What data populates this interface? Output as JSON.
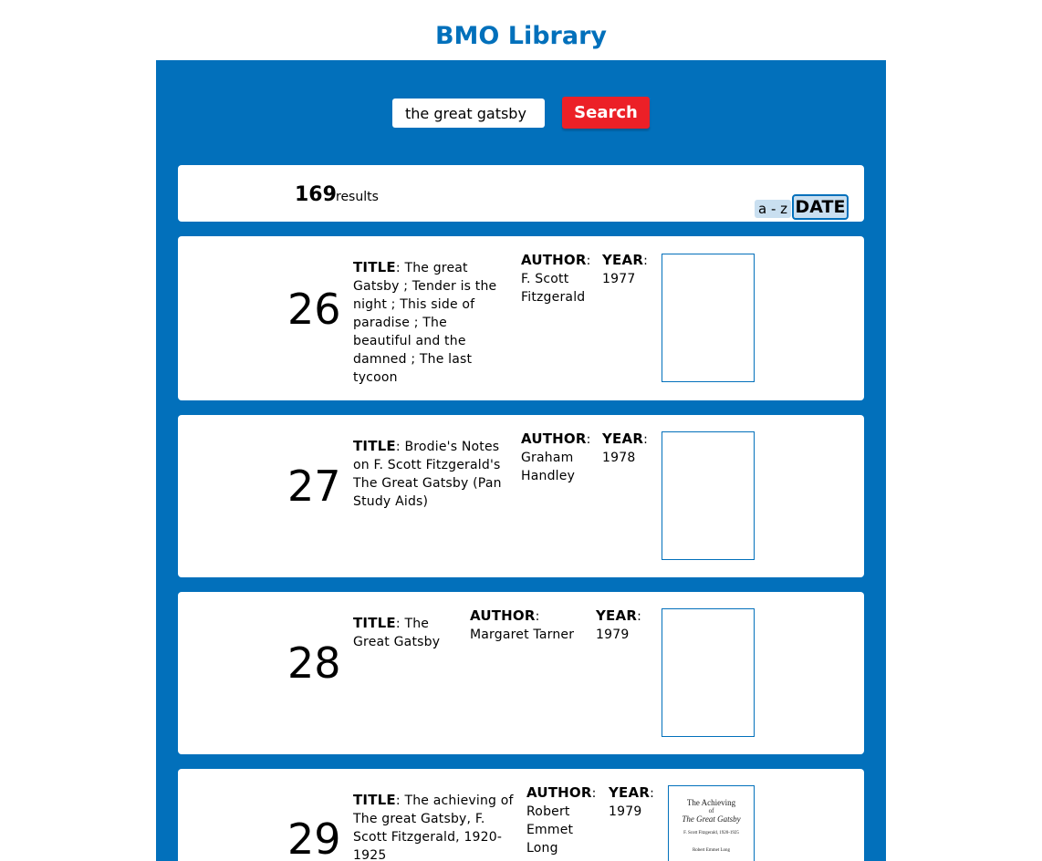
{
  "app": {
    "title": "BMO Library"
  },
  "search": {
    "value": "the great gatsby",
    "button_label": "Search"
  },
  "results": {
    "count": "169",
    "label": "results"
  },
  "sort": {
    "az_label": "a - z",
    "date_label": "DATE",
    "active": "DATE"
  },
  "labels": {
    "title": "TITLE",
    "author": "AUTHOR",
    "year": "YEAR",
    "sep": ":"
  },
  "books": [
    {
      "rank": "26",
      "title": "The great Gatsby ; Tender is the night ; This side of paradise ; The beautiful and the damned ; The last tycoon",
      "author": "F. Scott Fitzgerald",
      "year": "1977",
      "has_cover": false
    },
    {
      "rank": "27",
      "title": "Brodie's Notes on F. Scott Fitzgerald's The Great Gatsby (Pan Study Aids)",
      "author": "Graham Handley",
      "year": "1978",
      "has_cover": false
    },
    {
      "rank": "28",
      "title": "The Great Gatsby",
      "author": "Margaret Tarner",
      "year": "1979",
      "has_cover": false
    },
    {
      "rank": "29",
      "title": "The achieving of The great Gatsby, F. Scott Fitzgerald, 1920-1925",
      "author": "Robert Emmet Long",
      "year": "1979",
      "has_cover": true,
      "cover_text": {
        "line1": "The Achieving",
        "line2": "of",
        "line3": "The Great Gatsby",
        "line4": "F. Scott Fitzgerald, 1920-1925",
        "line5": "Robert Emmet Long"
      }
    }
  ]
}
